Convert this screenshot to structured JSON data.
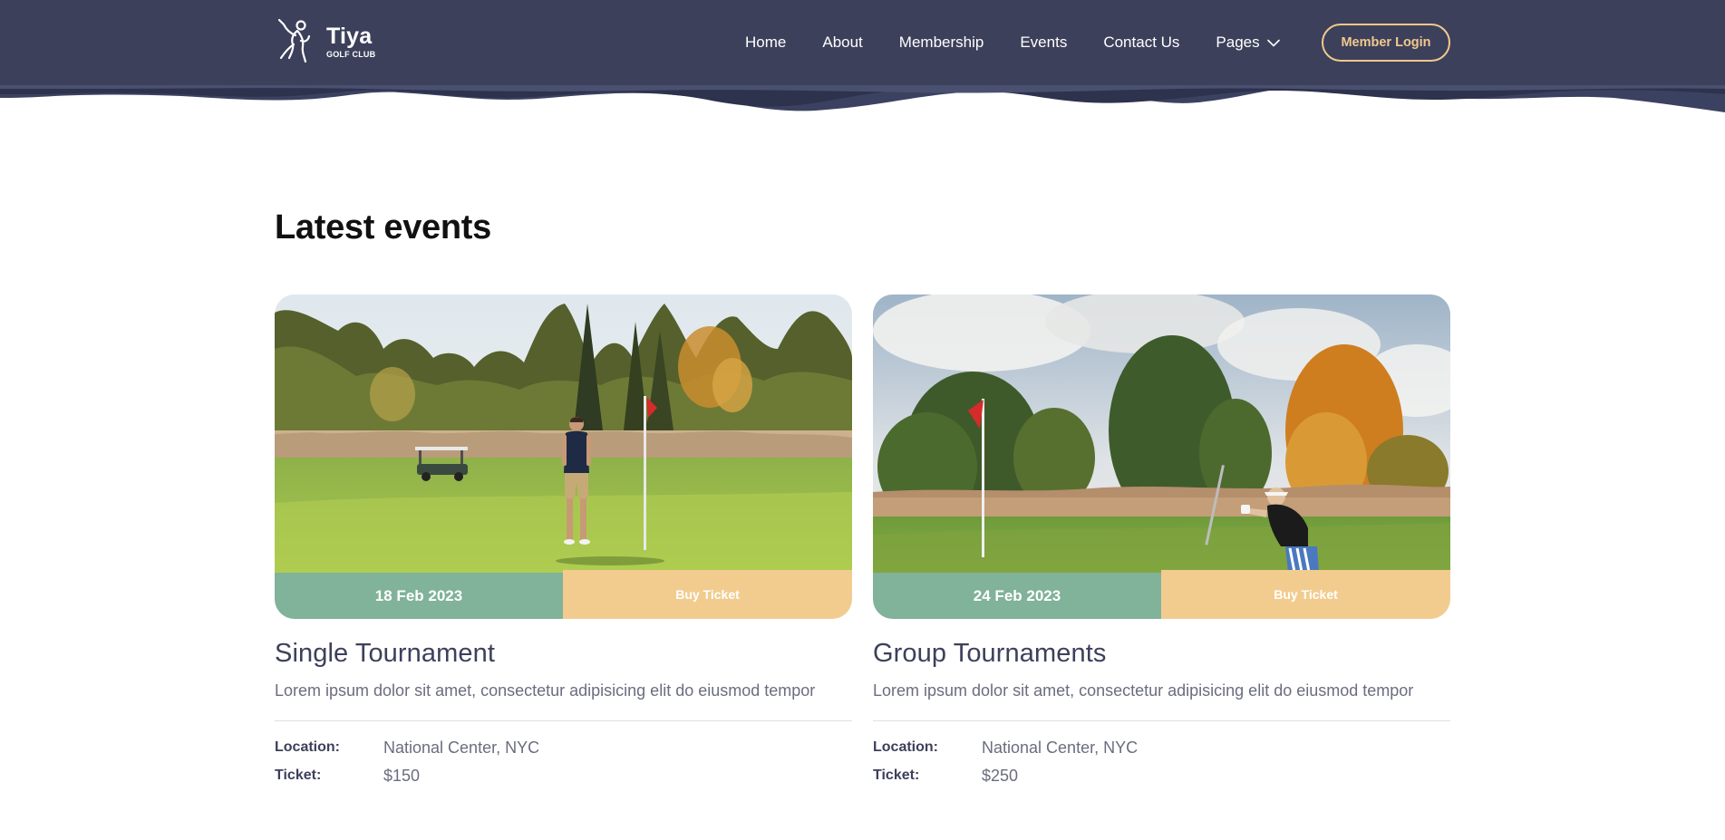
{
  "brand": {
    "name": "Tiya",
    "subtitle": "GOLF CLUB",
    "logo_icon": "golfer-icon"
  },
  "nav": {
    "items": [
      {
        "label": "Home"
      },
      {
        "label": "About"
      },
      {
        "label": "Membership"
      },
      {
        "label": "Events"
      },
      {
        "label": "Contact Us"
      },
      {
        "label": "Pages",
        "icon": "chevron-down-icon"
      }
    ],
    "login_label": "Member Login"
  },
  "section": {
    "title": "Latest events"
  },
  "events": [
    {
      "date": "18 Feb 2023",
      "ticket_button": "Buy Ticket",
      "title": "Single Tournament",
      "description": "Lorem ipsum dolor sit amet, consectetur adipisicing elit do eiusmod tempor",
      "location_label": "Location:",
      "location": "National Center, NYC",
      "ticket_label": "Ticket:",
      "price": "$150"
    },
    {
      "date": "24 Feb 2023",
      "ticket_button": "Buy Ticket",
      "title": "Group Tournaments",
      "description": "Lorem ipsum dolor sit amet, consectetur adipisicing elit do eiusmod tempor",
      "location_label": "Location:",
      "location": "National Center, NYC",
      "ticket_label": "Ticket:",
      "price": "$250"
    }
  ],
  "colors": {
    "nav_bg": "#3d405b",
    "accent_green": "#81b29a",
    "accent_sand": "#f2cc8f",
    "login_border": "#f0c98c"
  }
}
